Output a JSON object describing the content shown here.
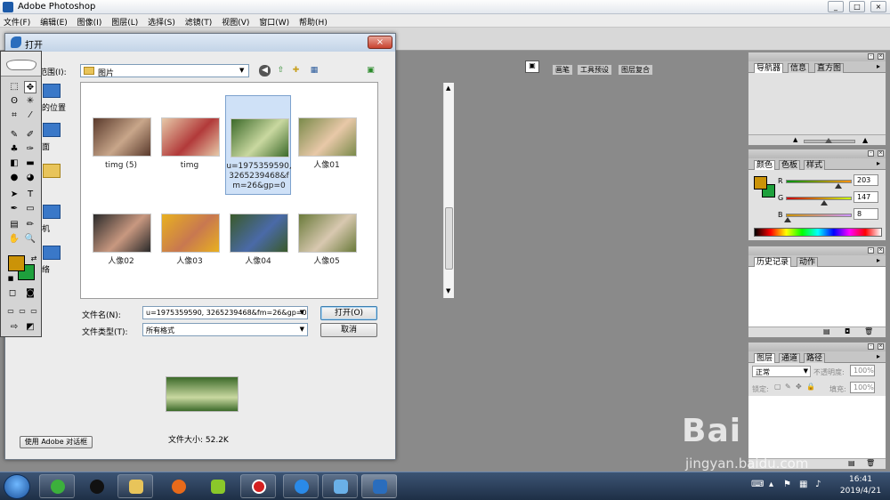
{
  "window": {
    "title": "Adobe Photoshop",
    "min": "_",
    "max": "□",
    "close": "×"
  },
  "menu": [
    "文件(F)",
    "编辑(E)",
    "图像(I)",
    "图层(L)",
    "选择(S)",
    "滤镜(T)",
    "视图(V)",
    "窗口(W)",
    "帮助(H)"
  ],
  "palette_well": {
    "tabs": [
      "画笔",
      "工具预设",
      "图层复合"
    ]
  },
  "dialog": {
    "title": "打开",
    "close": "×",
    "look_in_label": "范围(I):",
    "look_in_value": "图片",
    "places": [
      "问的位置",
      "桌面",
      "库",
      "算机",
      "网络"
    ],
    "files": [
      {
        "name": "timg (5)",
        "colors": [
          "#5a3a2c",
          "#c8a68a"
        ]
      },
      {
        "name": "timg",
        "colors": [
          "#e6c9a8",
          "#b23a3a"
        ]
      },
      {
        "name": "u=1975359590,3265239468&fm=26&gp=0",
        "colors": [
          "#3c6a2a",
          "#c9d8a0"
        ],
        "selected": true
      },
      {
        "name": "人像01",
        "colors": [
          "#7a8a4a",
          "#e8c8a8"
        ]
      },
      {
        "name": "人像02",
        "colors": [
          "#2a2a2a",
          "#c89880"
        ]
      },
      {
        "name": "人像03",
        "colors": [
          "#e8b020",
          "#c87850"
        ]
      },
      {
        "name": "人像04",
        "colors": [
          "#3a5a2a",
          "#4a6aa8"
        ]
      },
      {
        "name": "人像05",
        "colors": [
          "#6a7a3a",
          "#d8c8b0"
        ]
      }
    ],
    "filename_label": "文件名(N):",
    "filename_value": "u=1975359590, 3265239468&fm=26&gp=0",
    "filetype_label": "文件类型(T):",
    "filetype_value": "所有格式",
    "open_button": "打开(O)",
    "cancel_button": "取消",
    "file_size": "文件大小: 52.2K",
    "adobe_dialog_button": "使用 Adobe 对话框"
  },
  "panels": {
    "navigator": {
      "tabs": [
        "导航器",
        "信息",
        "直方图"
      ]
    },
    "color": {
      "tabs": [
        "颜色",
        "色板",
        "样式"
      ],
      "channels": [
        {
          "label": "R",
          "value": "203",
          "fraction": 0.796
        },
        {
          "label": "G",
          "value": "147",
          "fraction": 0.576
        },
        {
          "label": "B",
          "value": "8",
          "fraction": 0.031
        }
      ],
      "foreground": "#cb9308",
      "background": "#1ea03c"
    },
    "history": {
      "tabs": [
        "历史记录",
        "动作"
      ]
    },
    "layers": {
      "tabs": [
        "图层",
        "通道",
        "路径"
      ],
      "blend_mode": "正常",
      "opacity_label": "不透明度:",
      "opacity_value": "100%",
      "lock_label": "锁定:",
      "fill_label": "填充:",
      "fill_value": "100%"
    }
  },
  "taskbar": {
    "time": "16:41",
    "date": "2019/4/21"
  },
  "watermark": {
    "brand": "Bai  经验",
    "url": "jingyan.baidu.com"
  },
  "accent": {
    "title_blue": "#c3d4e7",
    "selection": "#cfe1f7",
    "close_red": "#c8422f"
  }
}
